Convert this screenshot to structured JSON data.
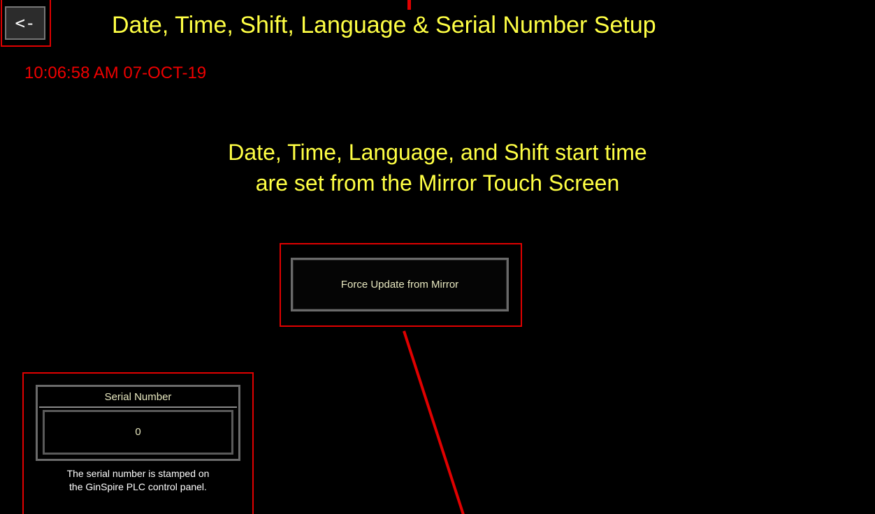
{
  "header": {
    "back_label": "<-",
    "title": "Date, Time, Shift, Language & Serial Number Setup"
  },
  "clock": {
    "datetime": "10:06:58 AM 07-OCT-19"
  },
  "info": {
    "line1": "Date, Time, Language, and Shift start time",
    "line2": "are set from the Mirror Touch Screen"
  },
  "actions": {
    "force_update_label": "Force Update from Mirror"
  },
  "serial": {
    "label": "Serial Number",
    "value": "0",
    "note_line1": "The serial number is stamped on",
    "note_line2": "the GinSpire PLC control panel."
  },
  "colors": {
    "background": "#000000",
    "title_yellow": "#ffff44",
    "clock_red": "#ee0000",
    "annotation_red": "#e00000",
    "button_border": "#6a6a6a"
  }
}
